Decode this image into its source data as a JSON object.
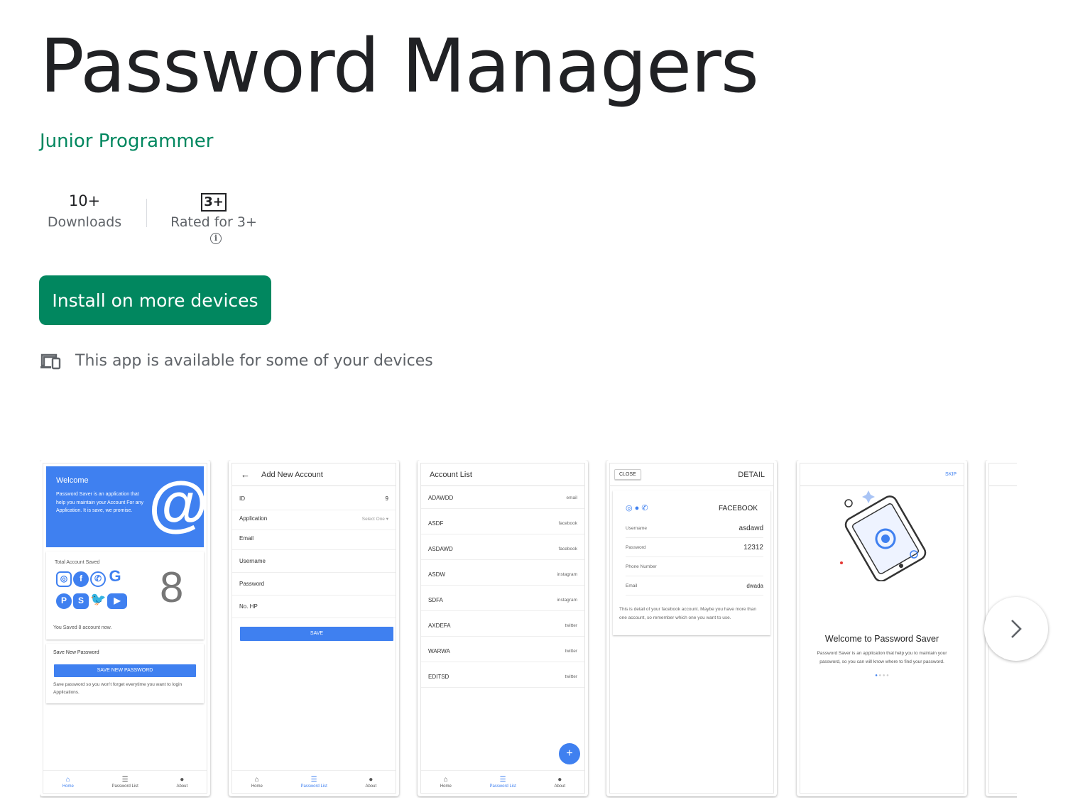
{
  "app": {
    "title": "Password Managers",
    "developer": "Junior Programmer",
    "downloads_value": "10+",
    "downloads_label": "Downloads",
    "rating_badge": "3+",
    "rating_label": "Rated for 3+",
    "install_label": "Install on more devices",
    "availability_text": "This app is available for some of your devices"
  },
  "colors": {
    "accent": "#01875f",
    "app_blue": "#3f80f0"
  },
  "shot1": {
    "welcome_title": "Welcome",
    "welcome_text": "Password Saver is an application that help you maintain your Account For any Application. It is save, we promise.",
    "total_label": "Total Account Saved",
    "count": "8",
    "saved_text": "You Saved 8 account now.",
    "save_title": "Save New Password",
    "save_button": "SAVE NEW PASSWORD",
    "save_note": "Save password so you won't forget everytime you want to login Applications.",
    "nav": [
      "Home",
      "Password List",
      "About"
    ]
  },
  "shot2": {
    "header": "Add New Account",
    "fields": [
      {
        "label": "ID",
        "value": "9"
      },
      {
        "label": "Application",
        "value": "Select One ▾"
      },
      {
        "label": "Email",
        "value": ""
      },
      {
        "label": "Username",
        "value": ""
      },
      {
        "label": "Password",
        "value": ""
      },
      {
        "label": "No. HP",
        "value": ""
      }
    ],
    "save_button": "SAVE",
    "nav": [
      "Home",
      "Password List",
      "About"
    ]
  },
  "shot3": {
    "header": "Account List",
    "rows": [
      {
        "name": "ADAWDD",
        "type": "email"
      },
      {
        "name": "ASDF",
        "type": "facebook"
      },
      {
        "name": "ASDAWD",
        "type": "facebook"
      },
      {
        "name": "ASDW",
        "type": "instagram"
      },
      {
        "name": "SDFA",
        "type": "instagram"
      },
      {
        "name": "AXDEFA",
        "type": "twitter"
      },
      {
        "name": "WARWA",
        "type": "twitter"
      },
      {
        "name": "EDITSD",
        "type": "twitter"
      }
    ],
    "fab": "+",
    "nav": [
      "Home",
      "Password List",
      "About"
    ]
  },
  "shot4": {
    "close": "CLOSE",
    "header": "DETAIL",
    "app_name": "FACEBOOK",
    "fields": [
      {
        "label": "Username",
        "value": "asdawd"
      },
      {
        "label": "Password",
        "value": "12312"
      },
      {
        "label": "Phone Number",
        "value": ""
      },
      {
        "label": "Email",
        "value": "dwada"
      }
    ],
    "note": "This is detail of your facebook account. Maybe you have more than one account, so remember which one you want to use."
  },
  "shot5": {
    "skip": "SKIP",
    "title": "Welcome to Password Saver",
    "text": "Password Saver is an application that help you to maintain your password, so you can will know where to find your password."
  }
}
